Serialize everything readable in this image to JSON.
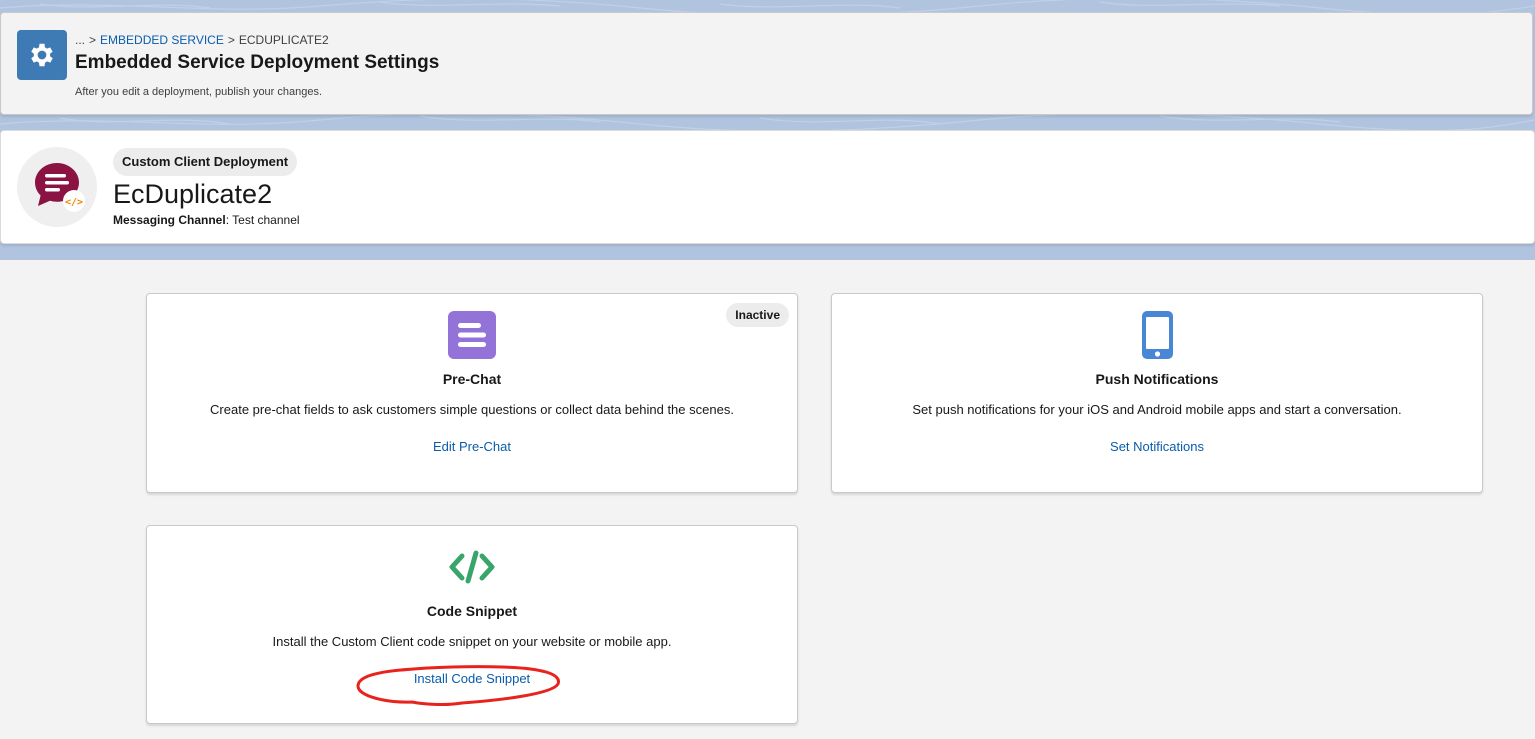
{
  "header": {
    "breadcrumb": {
      "ellipsis": "...",
      "separator": ">",
      "parent": "EMBEDDED SERVICE",
      "current": "ECDUPLICATE2"
    },
    "title": "Embedded Service Deployment Settings",
    "subtitle": "After you edit a deployment, publish your changes.",
    "icon": "gear-icon",
    "icon_color": "#3e7bb5"
  },
  "record": {
    "type_badge": "Custom Client Deployment",
    "name": "EcDuplicate2",
    "meta_label": "Messaging Channel",
    "meta_colon": ":",
    "meta_value": "Test channel",
    "avatar_icon": "chat-code-icon",
    "avatar_color": "#8b1343"
  },
  "tiles": [
    {
      "title": "Pre-Chat",
      "description": "Create pre-chat fields to ask customers simple questions or collect data behind the scenes.",
      "link": "Edit Pre-Chat",
      "status": "Inactive",
      "icon": "form-lines-icon",
      "icon_color": "#9373d8"
    },
    {
      "title": "Push Notifications",
      "description": "Set push notifications for your iOS and Android mobile apps and start a conversation.",
      "link": "Set Notifications",
      "icon": "mobile-phone-icon",
      "icon_color": "#4a86d6"
    },
    {
      "title": "Code Snippet",
      "description": "Install the Custom Client code snippet on your website or mobile app.",
      "link": "Install Code Snippet",
      "icon": "code-brackets-icon",
      "icon_color": "#3aa56b"
    }
  ],
  "colors": {
    "link": "#0b5cab",
    "annotation": "#e8231c"
  }
}
